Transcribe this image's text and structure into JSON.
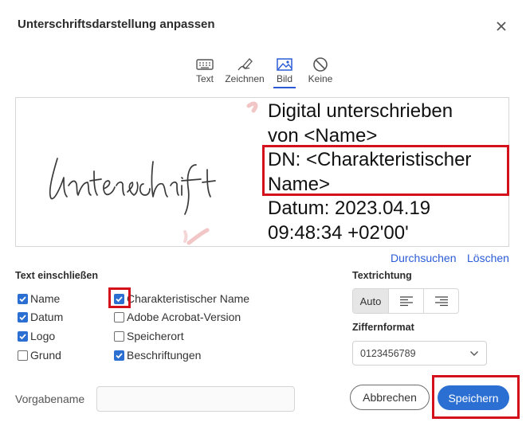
{
  "dialog": {
    "title": "Unterschriftsdarstellung anpassen"
  },
  "tabs": [
    {
      "label": "Text",
      "icon": "keyboard-icon"
    },
    {
      "label": "Zeichnen",
      "icon": "pen-icon"
    },
    {
      "label": "Bild",
      "icon": "image-icon",
      "active": true
    },
    {
      "label": "Keine",
      "icon": "none-icon"
    }
  ],
  "preview": {
    "signature_text": "Unterschrift",
    "lines": [
      "Digital unterschrieben",
      "von <Name>",
      "DN: <Charakteristischer",
      "Name>",
      "Datum: 2023.04.19",
      "09:48:34 +02'00'"
    ]
  },
  "links": {
    "browse": "Durchsuchen",
    "delete": "Löschen"
  },
  "include_text": {
    "heading": "Text einschließen",
    "options": [
      {
        "label": "Name",
        "checked": true
      },
      {
        "label": "Datum",
        "checked": true
      },
      {
        "label": "Logo",
        "checked": true
      },
      {
        "label": "Grund",
        "checked": false
      },
      {
        "label": "Charakteristischer Name",
        "checked": true
      },
      {
        "label": "Adobe Acrobat-Version",
        "checked": false
      },
      {
        "label": "Speicherort",
        "checked": false
      },
      {
        "label": "Beschriftungen",
        "checked": true
      }
    ]
  },
  "text_direction": {
    "heading": "Textrichtung",
    "auto_label": "Auto",
    "selected": "Auto"
  },
  "digit_format": {
    "heading": "Ziffernformat",
    "value": "0123456789"
  },
  "preset": {
    "label": "Vorgabename",
    "value": ""
  },
  "buttons": {
    "cancel": "Abbrechen",
    "save": "Speichern"
  },
  "colors": {
    "accent": "#2a6fd1",
    "highlight": "#d4111b"
  }
}
